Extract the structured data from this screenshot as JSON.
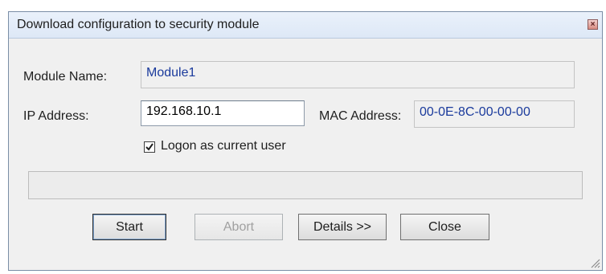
{
  "window": {
    "title": "Download configuration to security module",
    "close_glyph": "×"
  },
  "form": {
    "module_name_label": "Module Name:",
    "module_name_value": "Module1",
    "ip_label": "IP Address:",
    "ip_value": "192.168.10.1",
    "mac_label": "MAC Address:",
    "mac_value": "00-0E-8C-00-00-00",
    "logon_label": "Logon as current user",
    "logon_checked": true
  },
  "progress": {
    "fraction": 0
  },
  "buttons": {
    "start": "Start",
    "abort": "Abort",
    "details": "Details >>",
    "close": "Close"
  },
  "icons": {
    "close": "close-icon",
    "check": "checkmark-icon",
    "grip": "resize-grip-icon"
  }
}
